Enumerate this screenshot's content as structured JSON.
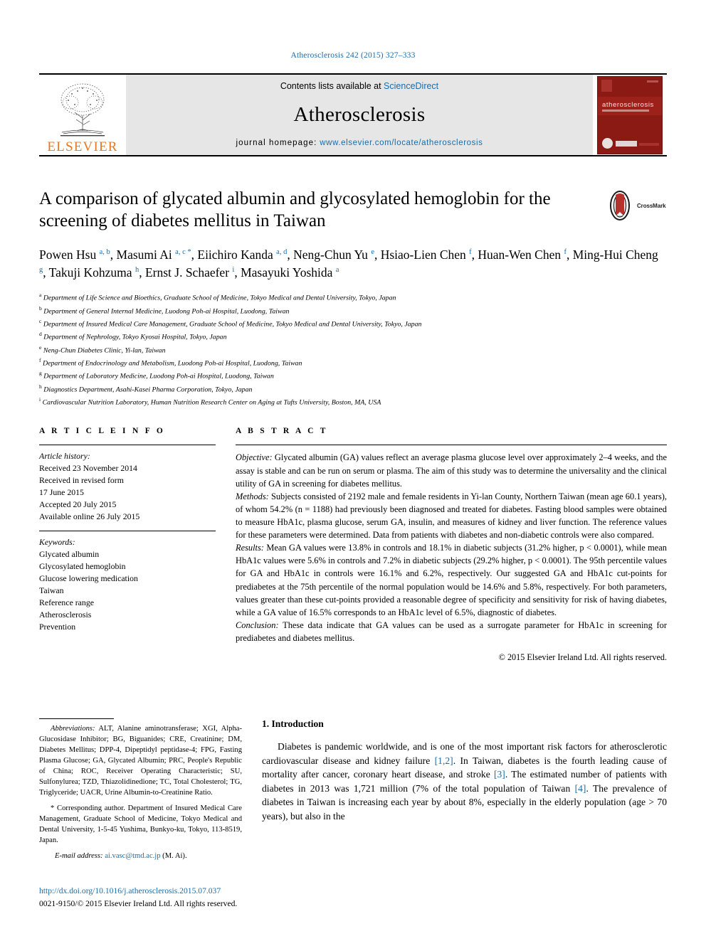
{
  "running_head": "Atherosclerosis 242 (2015) 327–333",
  "masthead": {
    "contents_prefix": "Contents lists available at ",
    "sciencedirect": "ScienceDirect",
    "journal_name": "Atherosclerosis",
    "homepage_label": "journal homepage:",
    "homepage_url": "www.elsevier.com/locate/atherosclerosis",
    "publisher": "ELSEVIER",
    "cover_title": "atherosclerosis"
  },
  "title": "A comparison of glycated albumin and glycosylated hemoglobin for the screening of diabetes mellitus in Taiwan",
  "crossmark_label": "CrossMark",
  "authors_html": "Powen Hsu <sup>a, b</sup>, Masumi Ai <sup>a, c</sup><sup class=\"star\"> *</sup>, Eiichiro Kanda <sup>a, d</sup>, Neng-Chun Yu <sup>e</sup>, Hsiao-Lien Chen <sup>f</sup>, Huan-Wen Chen <sup>f</sup>, Ming-Hui Cheng <sup>g</sup>, Takuji Kohzuma <sup>h</sup>, Ernst J. Schaefer <sup>i</sup>, Masayuki Yoshida <sup>a</sup>",
  "affiliations": [
    {
      "mark": "a",
      "text": "Department of Life Science and Bioethics, Graduate School of Medicine, Tokyo Medical and Dental University, Tokyo, Japan"
    },
    {
      "mark": "b",
      "text": "Department of General Internal Medicine, Luodong Poh-ai Hospital, Luodong, Taiwan"
    },
    {
      "mark": "c",
      "text": "Department of Insured Medical Care Management, Graduate School of Medicine, Tokyo Medical and Dental University, Tokyo, Japan"
    },
    {
      "mark": "d",
      "text": "Department of Nephrology, Tokyo Kyosai Hospital, Tokyo, Japan"
    },
    {
      "mark": "e",
      "text": "Neng-Chun Diabetes Clinic, Yi-lan, Taiwan"
    },
    {
      "mark": "f",
      "text": "Department of Endocrinology and Metabolism, Luodong Poh-ai Hospital, Luodong, Taiwan"
    },
    {
      "mark": "g",
      "text": "Department of Laboratory Medicine, Luodong Poh-ai Hospital, Luodong, Taiwan"
    },
    {
      "mark": "h",
      "text": "Diagnostics Department, Asahi-Kasei Pharma Corporation, Tokyo, Japan"
    },
    {
      "mark": "i",
      "text": "Cardiovascular Nutrition Laboratory, Human Nutrition Research Center on Aging at Tufts University, Boston, MA, USA"
    }
  ],
  "article_info": {
    "heading": "A R T I C L E   I N F O",
    "history_label": "Article history:",
    "history": [
      "Received 23 November 2014",
      "Received in revised form",
      "17 June 2015",
      "Accepted 20 July 2015",
      "Available online 26 July 2015"
    ],
    "keywords_label": "Keywords:",
    "keywords": [
      "Glycated albumin",
      "Glycosylated hemoglobin",
      "Glucose lowering medication",
      "Taiwan",
      "Reference range",
      "Atherosclerosis",
      "Prevention"
    ]
  },
  "abstract": {
    "heading": "A B S T R A C T",
    "objective_label": "Objective:",
    "objective_text": " Glycated albumin (GA) values reflect an average plasma glucose level over approximately 2–4 weeks, and the assay is stable and can be run on serum or plasma. The aim of this study was to determine the universality and the clinical utility of GA in screening for diabetes mellitus.",
    "methods_label": "Methods:",
    "methods_text": " Subjects consisted of 2192 male and female residents in Yi-lan County, Northern Taiwan (mean age 60.1 years), of whom 54.2% (n = 1188) had previously been diagnosed and treated for diabetes. Fasting blood samples were obtained to measure HbA1c, plasma glucose, serum GA, insulin, and measures of kidney and liver function. The reference values for these parameters were determined. Data from patients with diabetes and non-diabetic controls were also compared.",
    "results_label": "Results:",
    "results_text": " Mean GA values were 13.8% in controls and 18.1% in diabetic subjects (31.2% higher, p < 0.0001), while mean HbA1c values were 5.6% in controls and 7.2% in diabetic subjects (29.2% higher, p < 0.0001). The 95th percentile values for GA and HbA1c in controls were 16.1% and 6.2%, respectively. Our suggested GA and HbA1c cut-points for prediabetes at the 75th percentile of the normal population would be 14.6% and 5.8%, respectively. For both parameters, values greater than these cut-points provided a reasonable degree of specificity and sensitivity for risk of having diabetes, while a GA value of 16.5% corresponds to an HbA1c level of 6.5%, diagnostic of diabetes.",
    "conclusion_label": "Conclusion:",
    "conclusion_text": " These data indicate that GA values can be used as a surrogate parameter for HbA1c in screening for prediabetes and diabetes mellitus.",
    "copyright": "© 2015 Elsevier Ireland Ltd. All rights reserved."
  },
  "footnotes": {
    "abbreviations_label": "Abbreviations:",
    "abbreviations_text": " ALT, Alanine aminotransferase; XGI, Alpha-Glucosidase Inhibitor; BG, Biguanides; CRE, Creatinine; DM, Diabetes Mellitus; DPP-4, Dipeptidyl peptidase-4; FPG, Fasting Plasma Glucose; GA, Glycated Albumin; PRC, People's Republic of China; ROC, Receiver Operating Characteristic; SU, Sulfonylurea; TZD, Thiazolidinedione; TC, Total Cholesterol; TG, Triglyceride; UACR, Urine Albumin-to-Creatinine Ratio.",
    "corresponding_text": "* Corresponding author. Department of Insured Medical Care Management, Graduate School of Medicine, Tokyo Medical and Dental University, 1-5-45 Yushima, Bunkyo-ku, Tokyo, 113-8519, Japan.",
    "email_label": "E-mail address:",
    "email": "ai.vasc@tmd.ac.jp",
    "email_suffix": " (M. Ai)."
  },
  "introduction": {
    "heading": "1.  Introduction",
    "paragraph_html": "Diabetes is pandemic worldwide, and is one of the most important risk factors for atherosclerotic cardiovascular disease and kidney failure <span class=\"ref\">[1,2]</span>. In Taiwan, diabetes is the fourth leading cause of mortality after cancer, coronary heart disease, and stroke <span class=\"ref\">[3]</span>. The estimated number of patients with diabetes in 2013 was 1,721 million (7% of the total population of Taiwan <span class=\"ref\">[4]</span>. The prevalence of diabetes in Taiwan is increasing each year by about 8%, especially in the elderly population (age > 70 years), but also in the"
  },
  "doi_footer": {
    "doi_url": "http://dx.doi.org/10.1016/j.atherosclerosis.2015.07.037",
    "issn_line": "0021-9150/© 2015 Elsevier Ireland Ltd. All rights reserved."
  },
  "colors": {
    "link": "#1b6ca8",
    "elsevier_orange": "#E87722",
    "masthead_gray": "#e6e6e6",
    "cover_red": "#8b1a15"
  }
}
